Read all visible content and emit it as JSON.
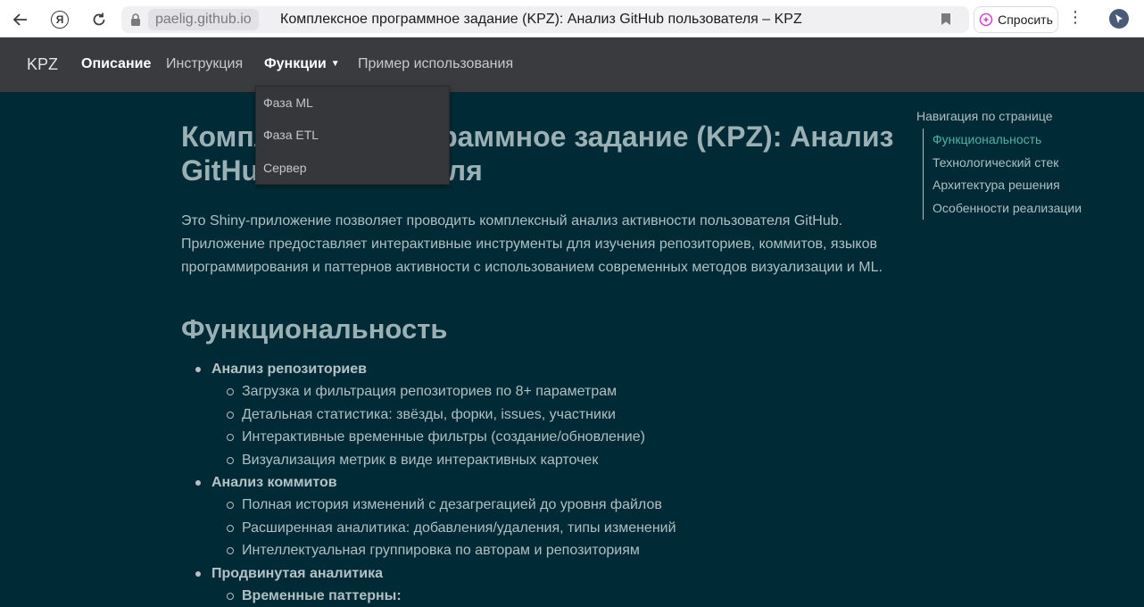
{
  "browser": {
    "host": "paelig.github.io",
    "tab_title": "Комплексное программное задание (KPZ): Анализ GitHub пользователя – KPZ",
    "ask_label": "Спросить"
  },
  "navbar": {
    "brand": "KPZ",
    "links": [
      {
        "label": "Описание"
      },
      {
        "label": "Инструкция"
      },
      {
        "label": "Функции"
      },
      {
        "label": "Пример использования"
      }
    ]
  },
  "dropdown": {
    "items": [
      {
        "label": "Фаза ML"
      },
      {
        "label": "Фаза ETL"
      },
      {
        "label": "Сервер"
      }
    ]
  },
  "main": {
    "title": "Комплексное программное задание (KPZ): Анализ GitHub пользователя",
    "intro": "Это Shiny-приложение позволяет проводить комплексный анализ активности пользователя GitHub. Приложение предоставляет интерактивные инструменты для изучения репозиториев, коммитов, языков программирования и паттернов активности с использованием современных методов визуализации и ML.",
    "section_title": "Функциональность",
    "features": [
      {
        "title": "Анализ репозиториев",
        "items": [
          "Загрузка и фильтрация репозиториев по 8+ параметрам",
          "Детальная статистика: звёзды, форки, issues, участники",
          "Интерактивные временные фильтры (создание/обновление)",
          "Визуализация метрик в виде интерактивных карточек"
        ]
      },
      {
        "title": "Анализ коммитов",
        "items": [
          "Полная история изменений с дезагрегацией до уровня файлов",
          "Расширенная аналитика: добавления/удаления, типы изменений",
          "Интеллектуальная группировка по авторам и репозиториям"
        ]
      },
      {
        "title": "Продвинутая аналитика",
        "items": [
          "Временные паттерны:"
        ]
      }
    ]
  },
  "toc": {
    "title": "Навигация по странице",
    "items": [
      {
        "label": "Функциональность"
      },
      {
        "label": "Технологический стек"
      },
      {
        "label": "Архитектура решения"
      },
      {
        "label": "Особенности реализации"
      }
    ]
  },
  "colors": {
    "page_bg": "#002b36",
    "navbar_bg": "#3a3b3e",
    "toc_active": "#4fb3a3"
  }
}
